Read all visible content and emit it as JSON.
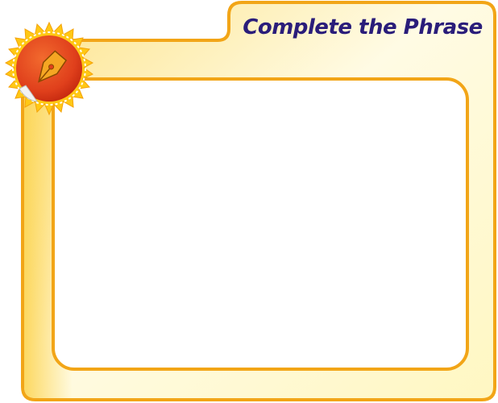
{
  "card": {
    "title": "Complete the Phrase"
  },
  "colors": {
    "frame_border": "#f2a517",
    "frame_fill_light": "#fffbd9",
    "frame_fill_warm": "#fde38a",
    "title_text": "#2a1d7a",
    "badge_sun": "#ffc814",
    "badge_disc": "#e0401c",
    "pen_nib": "#f5a623"
  },
  "icons": {
    "badge": "fountain-pen-nib-icon"
  }
}
